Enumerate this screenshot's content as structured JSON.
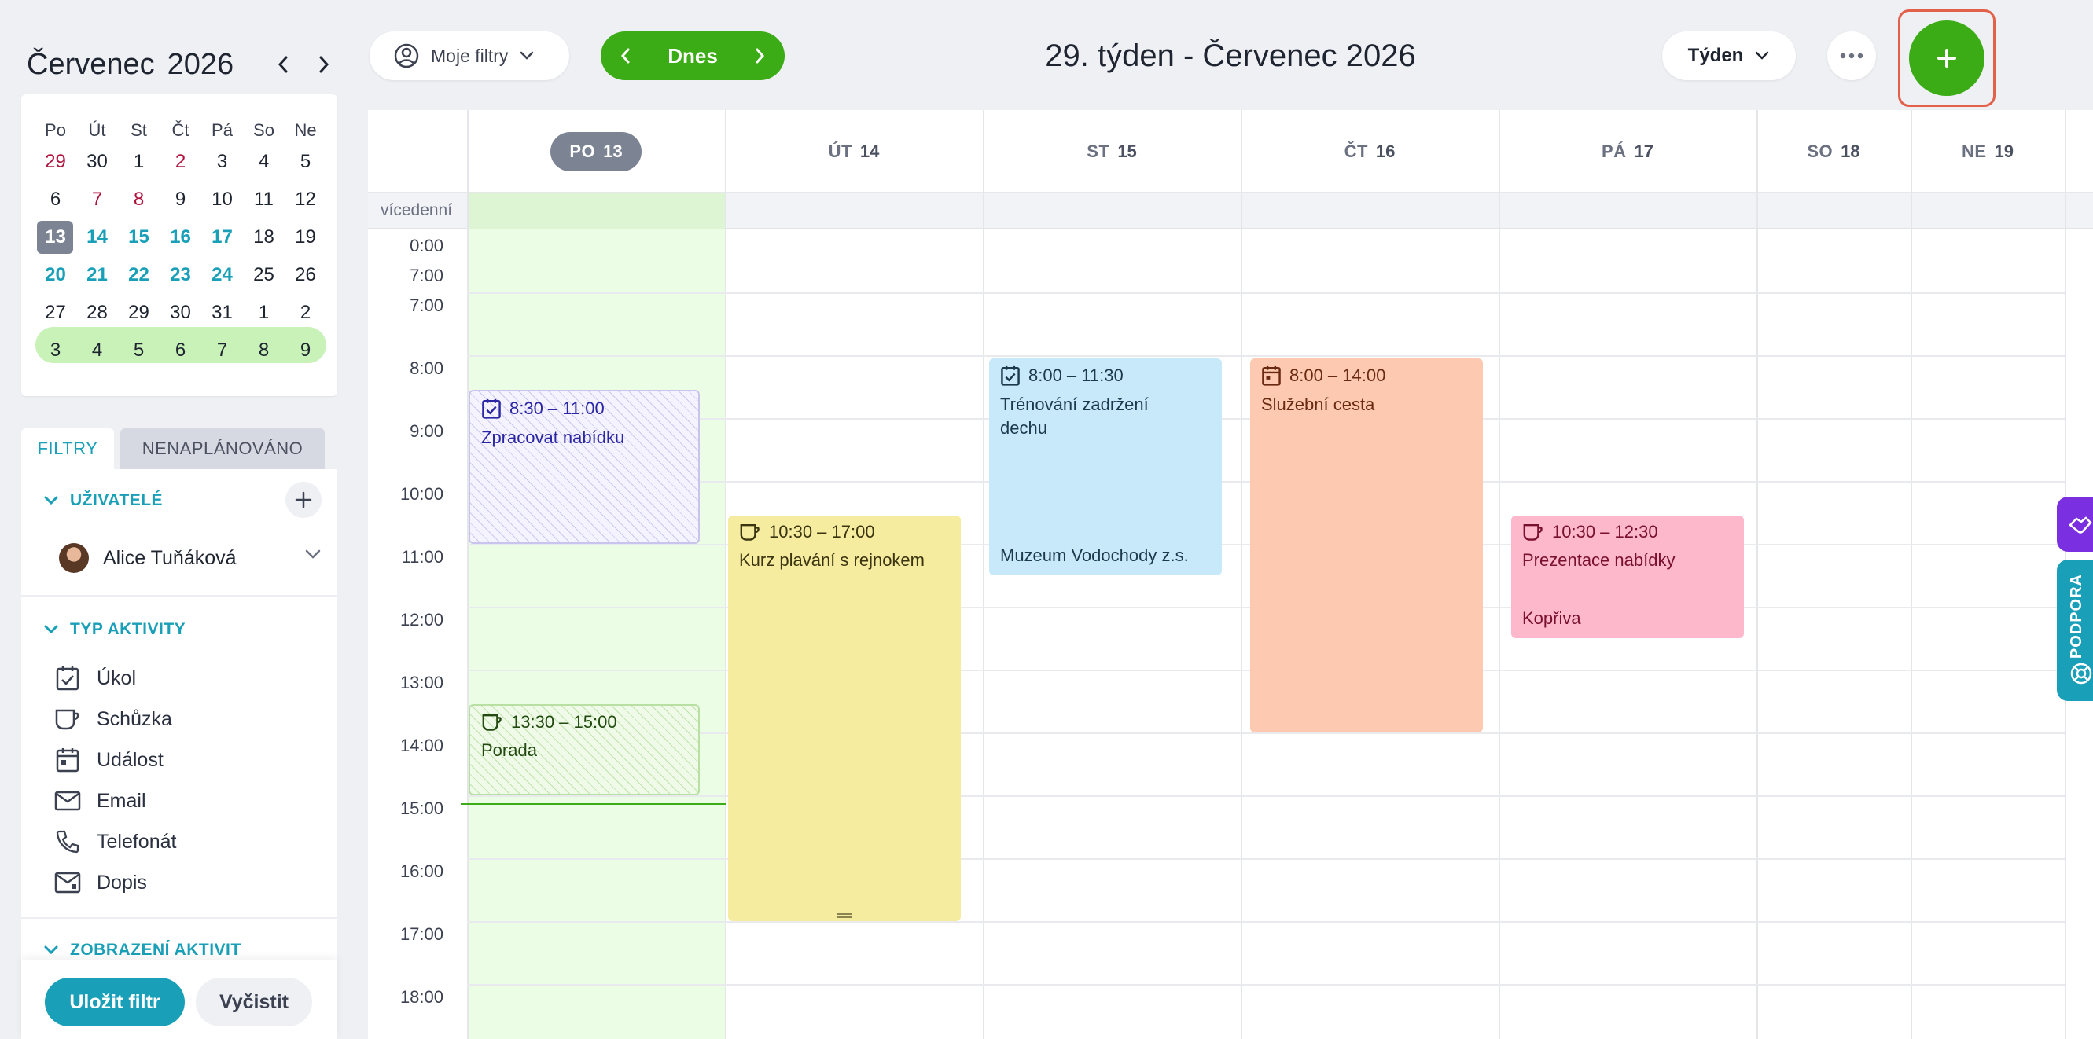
{
  "mini_calendar": {
    "month": "Červenec",
    "year": "2026",
    "dow": [
      "Po",
      "Út",
      "St",
      "Čt",
      "Pá",
      "So",
      "Ne"
    ],
    "weeks": [
      [
        {
          "d": "29",
          "s": "red"
        },
        {
          "d": "30",
          "s": ""
        },
        {
          "d": "1",
          "s": ""
        },
        {
          "d": "2",
          "s": "red"
        },
        {
          "d": "3",
          "s": ""
        },
        {
          "d": "4",
          "s": ""
        },
        {
          "d": "5",
          "s": ""
        }
      ],
      [
        {
          "d": "6",
          "s": ""
        },
        {
          "d": "7",
          "s": "red"
        },
        {
          "d": "8",
          "s": "red"
        },
        {
          "d": "9",
          "s": ""
        },
        {
          "d": "10",
          "s": ""
        },
        {
          "d": "11",
          "s": ""
        },
        {
          "d": "12",
          "s": ""
        }
      ],
      [
        {
          "d": "13",
          "s": "cur"
        },
        {
          "d": "14",
          "s": "teal"
        },
        {
          "d": "15",
          "s": "teal"
        },
        {
          "d": "16",
          "s": "teal"
        },
        {
          "d": "17",
          "s": "teal"
        },
        {
          "d": "18",
          "s": ""
        },
        {
          "d": "19",
          "s": ""
        }
      ],
      [
        {
          "d": "20",
          "s": "teal"
        },
        {
          "d": "21",
          "s": "teal"
        },
        {
          "d": "22",
          "s": "teal"
        },
        {
          "d": "23",
          "s": "teal"
        },
        {
          "d": "24",
          "s": "teal"
        },
        {
          "d": "25",
          "s": ""
        },
        {
          "d": "26",
          "s": ""
        }
      ],
      [
        {
          "d": "27",
          "s": ""
        },
        {
          "d": "28",
          "s": ""
        },
        {
          "d": "29",
          "s": ""
        },
        {
          "d": "30",
          "s": ""
        },
        {
          "d": "31",
          "s": ""
        },
        {
          "d": "1",
          "s": ""
        },
        {
          "d": "2",
          "s": ""
        }
      ],
      [
        {
          "d": "3",
          "s": ""
        },
        {
          "d": "4",
          "s": ""
        },
        {
          "d": "5",
          "s": ""
        },
        {
          "d": "6",
          "s": ""
        },
        {
          "d": "7",
          "s": ""
        },
        {
          "d": "8",
          "s": ""
        },
        {
          "d": "9",
          "s": ""
        }
      ]
    ]
  },
  "tabs": {
    "filters": "FILTRY",
    "unplanned": "NENAPLÁNOVÁNO"
  },
  "filters": {
    "users_heading": "UŽIVATELÉ",
    "user_name": "Alice Tuňáková",
    "activity_heading": "TYP AKTIVITY",
    "activity_types": [
      "Úkol",
      "Schůzka",
      "Událost",
      "Email",
      "Telefonát",
      "Dopis"
    ],
    "display_heading": "ZOBRAZENÍ AKTIVIT",
    "save_label": "Uložit filtr",
    "clear_label": "Vyčistit"
  },
  "toolbar": {
    "my_filters": "Moje filtry",
    "today": "Dnes",
    "week_title": "29. týden - Červenec 2026",
    "view": "Týden"
  },
  "calendar": {
    "multi_day_label": "vícedenní",
    "days": [
      {
        "dow": "PO",
        "num": "13",
        "today": true
      },
      {
        "dow": "ÚT",
        "num": "14"
      },
      {
        "dow": "ST",
        "num": "15"
      },
      {
        "dow": "ČT",
        "num": "16"
      },
      {
        "dow": "PÁ",
        "num": "17"
      },
      {
        "dow": "SO",
        "num": "18"
      },
      {
        "dow": "NE",
        "num": "19"
      }
    ],
    "hour_labels": [
      "0:00",
      "7:00",
      "7:00",
      "8:00",
      "9:00",
      "10:00",
      "11:00",
      "12:00",
      "13:00",
      "14:00",
      "15:00",
      "16:00",
      "17:00",
      "18:00"
    ],
    "events": [
      {
        "time": "8:30 – 11:00",
        "title": "Zpracovat nabídku",
        "sub": "",
        "icon": "task"
      },
      {
        "time": "13:30 – 15:00",
        "title": "Porada",
        "sub": "",
        "icon": "meeting"
      },
      {
        "time": "10:30 – 17:00",
        "title": "Kurz plavání s rejnokem",
        "sub": "",
        "icon": "meeting"
      },
      {
        "time": "8:00 – 11:30",
        "title": "Trénování zadržení dechu",
        "sub": "Muzeum Vodochody z.s.",
        "icon": "task"
      },
      {
        "time": "8:00 – 14:00",
        "title": "Služební cesta",
        "sub": "",
        "icon": "event"
      },
      {
        "time": "10:30 – 12:30",
        "title": "Prezentace nabídky",
        "sub": "Kopřiva",
        "icon": "meeting"
      }
    ]
  },
  "support_label": "PODPORA"
}
